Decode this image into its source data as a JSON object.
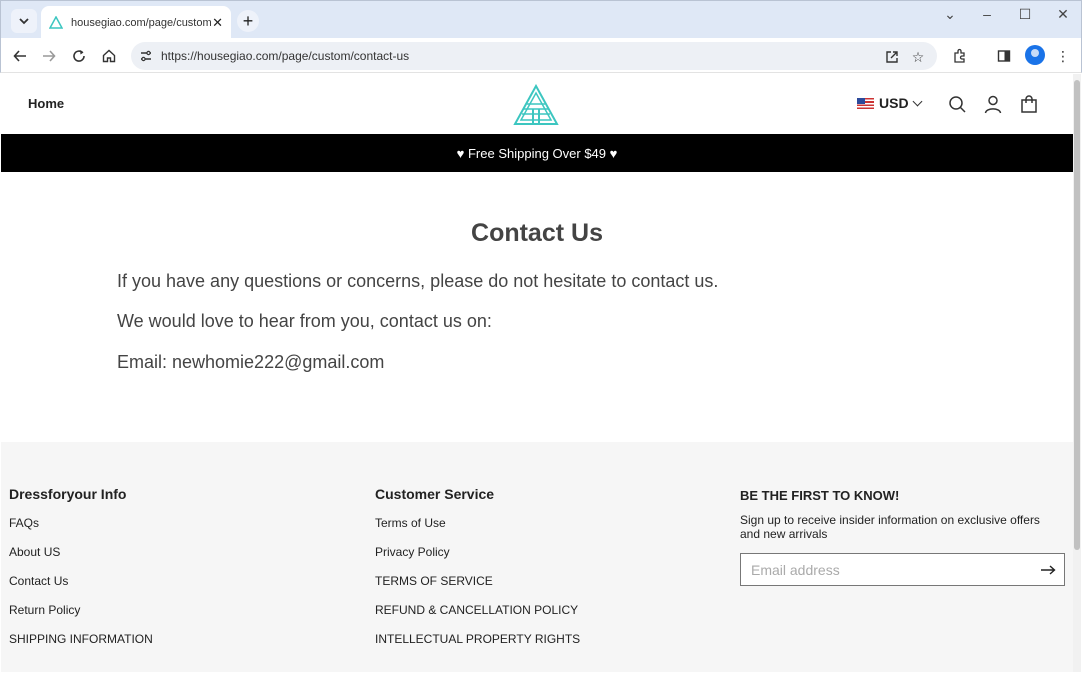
{
  "browser": {
    "tab_title": "housegiao.com/page/custom/contact-us",
    "url": "https://housegiao.com/page/custom/contact-us"
  },
  "header": {
    "home_label": "Home",
    "currency": "USD"
  },
  "promo": {
    "text": "♥ Free Shipping Over $49 ♥"
  },
  "main": {
    "title": "Contact Us",
    "paragraphs": [
      "If you have any questions or concerns, please do not hesitate to contact us.",
      "We would love to hear from you, contact us on:",
      "Email: newhomie222@gmail.com"
    ]
  },
  "footer": {
    "info": {
      "heading": "Dressforyour Info",
      "links": [
        "FAQs",
        "About US",
        "Contact Us",
        "Return Policy",
        "SHIPPING INFORMATION"
      ]
    },
    "service": {
      "heading": "Customer Service",
      "links": [
        "Terms of Use",
        "Privacy Policy",
        "TERMS OF SERVICE",
        "REFUND & CANCELLATION POLICY",
        "INTELLECTUAL PROPERTY RIGHTS"
      ]
    },
    "newsletter": {
      "heading": "BE THE FIRST TO KNOW!",
      "subtext": "Sign up to receive insider information on exclusive offers and new arrivals",
      "placeholder": "Email address"
    }
  },
  "colors": {
    "promo_bg": "#000000",
    "logo_teal": "#3cc6c0",
    "footer_bg": "#f6f6f6"
  },
  "icons": [
    "tab-search-icon",
    "close-icon",
    "plus-icon",
    "back-icon",
    "forward-icon",
    "reload-icon",
    "home-icon",
    "site-settings-icon",
    "share-icon",
    "star-icon",
    "extensions-icon",
    "sidepanel-icon",
    "profile-icon",
    "menu-icon",
    "search-icon",
    "account-icon",
    "cart-icon",
    "arrow-right-icon"
  ]
}
